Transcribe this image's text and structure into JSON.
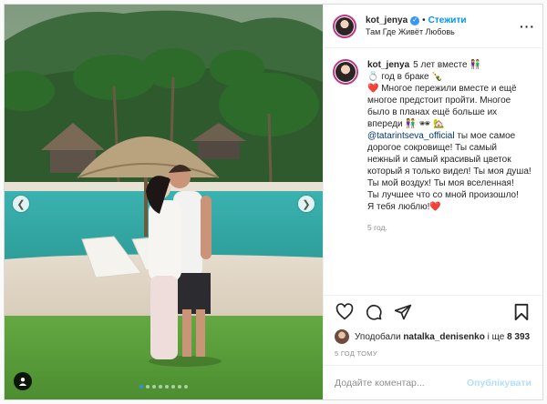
{
  "post": {
    "author": {
      "username": "kot_jenya",
      "verified_icon": "verified-badge-icon",
      "follow_label": "Стежити",
      "separator": "•",
      "location": "Там Где Живёт Любовь"
    },
    "caption": {
      "username": "kot_jenya",
      "lines": [
        "5 лет вместе 👫",
        "💍 год в браке 🍾",
        "❤️ Многое пережили вместе и ещё многое предстоит пройти. Многое было в планах ещё больше их впереди 👫 🕶 🏡"
      ],
      "mention": "@tatarintseva_official",
      "mention_tail": " ты мое самое дорогое сокровище! Ты самый нежный и самый красивый цветок который я только видел! Ты моя душа! Ты мой воздух! Ты моя вселенная!",
      "line_after": "Ты лучшее что со мной произошло!",
      "closing": "Я тебя люблю!❤️",
      "age": "5 год."
    },
    "carousel": {
      "dot_count": 8,
      "active_index": 0,
      "prev_icon": "chevron-left-icon",
      "next_icon": "chevron-right-icon",
      "tag_icon": "user-tag-icon"
    },
    "likes": {
      "prefix": "Уподобали",
      "user": "natalka_denisenko",
      "connector": "і ще",
      "count": "8 393"
    },
    "posted_ago": "5 ГОД ТОМУ",
    "comment": {
      "placeholder": "Додайте коментар...",
      "publish_label": "Опублікувати"
    }
  },
  "colors": {
    "accent": "#0095f6",
    "verified": "#3897f0",
    "like_heart": "#ed4956",
    "muted": "#8e8e8e"
  }
}
